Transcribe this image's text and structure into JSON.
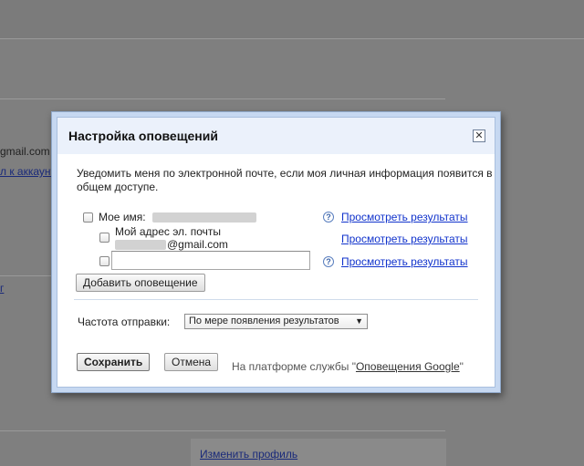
{
  "background": {
    "text_gmail": "gmail.com",
    "text_account_link": "л к аккаунт",
    "text_edit_profile": "Изменить профиль"
  },
  "dialog": {
    "title": "Настройка оповещений",
    "close_symbol": "✕",
    "description": "Уведомить меня по электронной почте, если моя личная информация появится в общем доступе.",
    "my_name_label": "Мое имя:",
    "my_email_label": "Мой адрес эл. почты",
    "email_suffix": "@gmail.com",
    "view_results_link": "Просмотреть результаты",
    "custom_alert_value": "",
    "add_alert_button": "Добавить оповещение",
    "frequency_label": "Частота отправки:",
    "frequency_selected": "По мере появления результатов",
    "save_button": "Сохранить",
    "cancel_button": "Отмена",
    "powered_by_prefix": "На платформе службы \"",
    "powered_by_link": "Оповещения Google",
    "powered_by_suffix": "\"",
    "help_symbol": "?"
  },
  "colors": {
    "overlay": "#7f7f7f",
    "dialog_frame": "#c6d8f1",
    "header_bg": "#ebf1fb",
    "link": "#1133cc"
  },
  "icons": [
    "close-icon",
    "help-icon",
    "dropdown-arrow-icon"
  ]
}
